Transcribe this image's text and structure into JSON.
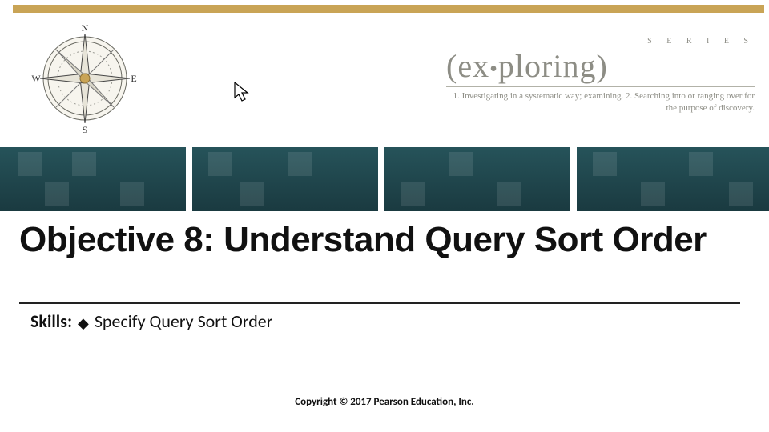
{
  "brand": {
    "series_label": "S E R I E S",
    "wordmark_prefix": "(ex",
    "wordmark_suffix": "ploring)",
    "definition": "1. Investigating in a systematic way; examining. 2. Searching into or ranging over for the purpose of discovery."
  },
  "compass": {
    "n": "N",
    "s": "S",
    "e": "E",
    "w": "W"
  },
  "title": "Objective 8: Understand Query Sort Order",
  "skills": {
    "label": "Skills:",
    "item": "Specify Query Sort Order"
  },
  "copyright": "Copyright © 2017 Pearson Education, Inc."
}
